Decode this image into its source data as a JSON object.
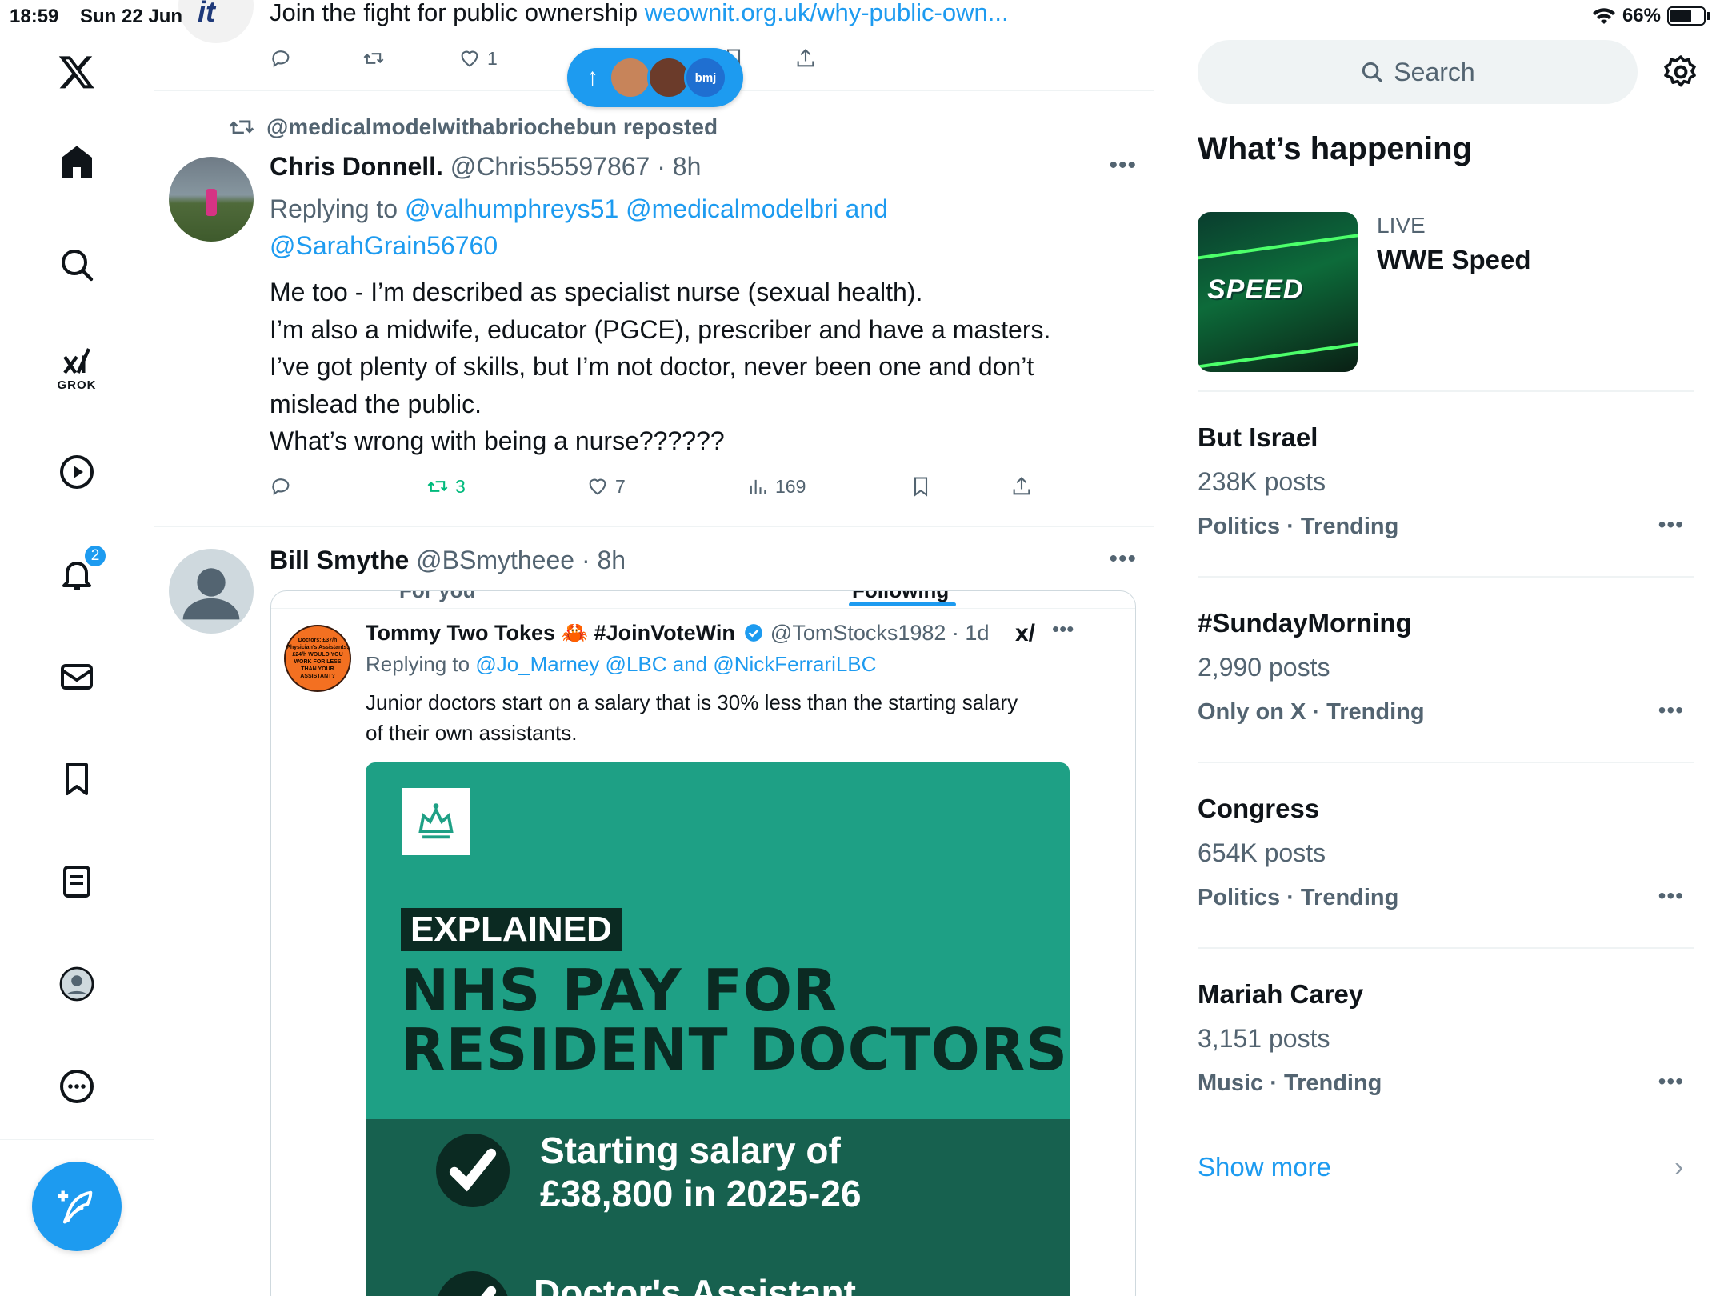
{
  "status_bar": {
    "time": "18:59",
    "date": "Sun 22 Jun",
    "battery": "66%",
    "battery_level": 0.66
  },
  "nav": {
    "grok_label": "GROK",
    "notifications_badge": "2",
    "icons": [
      "x-logo-icon",
      "home-icon",
      "search-icon",
      "grok-icon",
      "video-icon",
      "notifications-icon",
      "messages-icon",
      "bookmarks-icon",
      "lists-icon",
      "profile-icon",
      "more-icon",
      "compose-icon"
    ]
  },
  "prev_post": {
    "logo_text": "it",
    "text": "Join the fight for public ownership ",
    "link": "weownit.org.uk/why-public-own...",
    "likes": "1"
  },
  "new_posts_pill": {
    "label": "bmj"
  },
  "post1": {
    "repost_line": "@medicalmodelwithabriochebun reposted",
    "name": "Chris Donnell.",
    "handle": "@Chris55597867",
    "time": "8h",
    "reply_prefix": "Replying to ",
    "reply_handles_line1": "@valhumphreys51 @medicalmodelbri and",
    "reply_handles_line2": "@SarahGrain56760",
    "body": [
      "Me too - I’m described as specialist nurse (sexual health).",
      "I’m also a midwife, educator (PGCE), prescriber and have a masters.",
      "I’ve got plenty of skills, but I’m not doctor, never been one and don’t",
      "mislead the public.",
      "What’s wrong with being a nurse??????"
    ],
    "reposts": "3",
    "likes": "7",
    "views": "169"
  },
  "post2": {
    "name": "Bill Smythe",
    "handle": "@BSmytheee",
    "time": "8h",
    "embed": {
      "tab_left": "For you",
      "tab_right": "Following",
      "name": "Tommy Two Tokes 🦀 #JoinVoteWin",
      "handle": "@TomStocks1982 · 1d",
      "reply_prefix": "Replying to ",
      "reply_handles": "@Jo_Marney @LBC and @NickFerrariLBC",
      "text": [
        "Junior doctors start on a salary that is 30% less than the starting salary",
        "of their own assistants."
      ],
      "avatar_text": "Doctors: £37/h Physician's Assistants: £24/h WOULD YOU WORK FOR LESS THAN YOUR ASSISTANT?",
      "card": {
        "explained": "EXPLAINED",
        "title_line1": "NHS PAY FOR",
        "title_line2": "RESIDENT DOCTORS",
        "salary_line1": "Starting salary of",
        "salary_line2": "£38,800 in 2025-26",
        "next_line": "Doctor's Assistant"
      }
    }
  },
  "sidebar": {
    "search_placeholder": "Search",
    "section_title": "What’s happening",
    "live_label": "LIVE",
    "live_title": "WWE Speed",
    "live_thumb_text": "SPEED",
    "trends": [
      {
        "name": "But Israel",
        "count": "238K posts",
        "meta": "Politics · Trending"
      },
      {
        "name": "#SundayMorning",
        "count": "2,990 posts",
        "meta": "Only on X · Trending"
      },
      {
        "name": "Congress",
        "count": "654K posts",
        "meta": "Politics · Trending"
      },
      {
        "name": "Mariah Carey",
        "count": "3,151 posts",
        "meta": "Music · Trending"
      }
    ],
    "show_more": "Show more"
  },
  "colors": {
    "accent": "#1d9bf0",
    "repost_green": "#00ba7c",
    "secondary_text": "#536471",
    "nhs_green": "#1ea085"
  }
}
